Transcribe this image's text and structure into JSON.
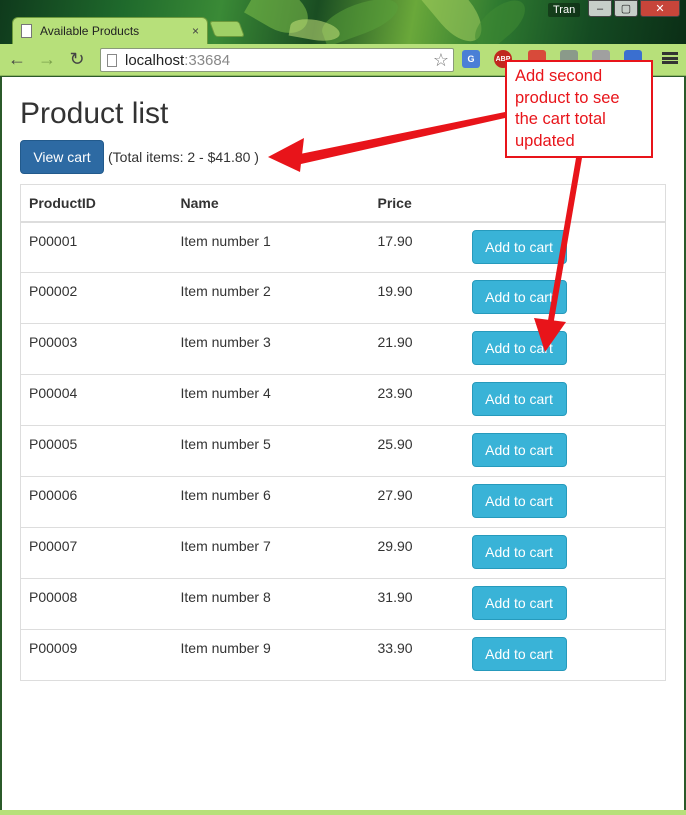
{
  "browser": {
    "tab_title": "Available Products",
    "tab_close": "×",
    "user_name": "Tran",
    "window_controls": [
      "‒",
      "▢",
      "✕"
    ],
    "address": {
      "host": "localhost",
      "port": ":33684"
    },
    "back_glyph": "←",
    "forward_glyph": "→",
    "reload_glyph": "↻",
    "star_glyph": "☆",
    "extensions": [
      "G",
      "ABP",
      "",
      "",
      "",
      ""
    ],
    "extension_colors": [
      "#4a7fd6",
      "#c0281e",
      "#d84a3a",
      "#8a9a8a",
      "#a0a0a0",
      "#3a6fd0"
    ]
  },
  "page": {
    "title": "Product list",
    "view_cart_label": "View cart",
    "cart_summary": "(Total items: 2 - $41.80 )",
    "table": {
      "headers": [
        "ProductID",
        "Name",
        "Price",
        ""
      ],
      "rows": [
        {
          "id": "P00001",
          "name": "Item number 1",
          "price": "17.90",
          "action": "Add to cart"
        },
        {
          "id": "P00002",
          "name": "Item number 2",
          "price": "19.90",
          "action": "Add to cart"
        },
        {
          "id": "P00003",
          "name": "Item number 3",
          "price": "21.90",
          "action": "Add to cart"
        },
        {
          "id": "P00004",
          "name": "Item number 4",
          "price": "23.90",
          "action": "Add to cart"
        },
        {
          "id": "P00005",
          "name": "Item number 5",
          "price": "25.90",
          "action": "Add to cart"
        },
        {
          "id": "P00006",
          "name": "Item number 6",
          "price": "27.90",
          "action": "Add to cart"
        },
        {
          "id": "P00007",
          "name": "Item number 7",
          "price": "29.90",
          "action": "Add to cart"
        },
        {
          "id": "P00008",
          "name": "Item number 8",
          "price": "31.90",
          "action": "Add to cart"
        },
        {
          "id": "P00009",
          "name": "Item number 9",
          "price": "33.90",
          "action": "Add to cart"
        }
      ]
    }
  },
  "annotation": {
    "text": "Add second product to see the cart total updated",
    "color": "#e8141a"
  }
}
